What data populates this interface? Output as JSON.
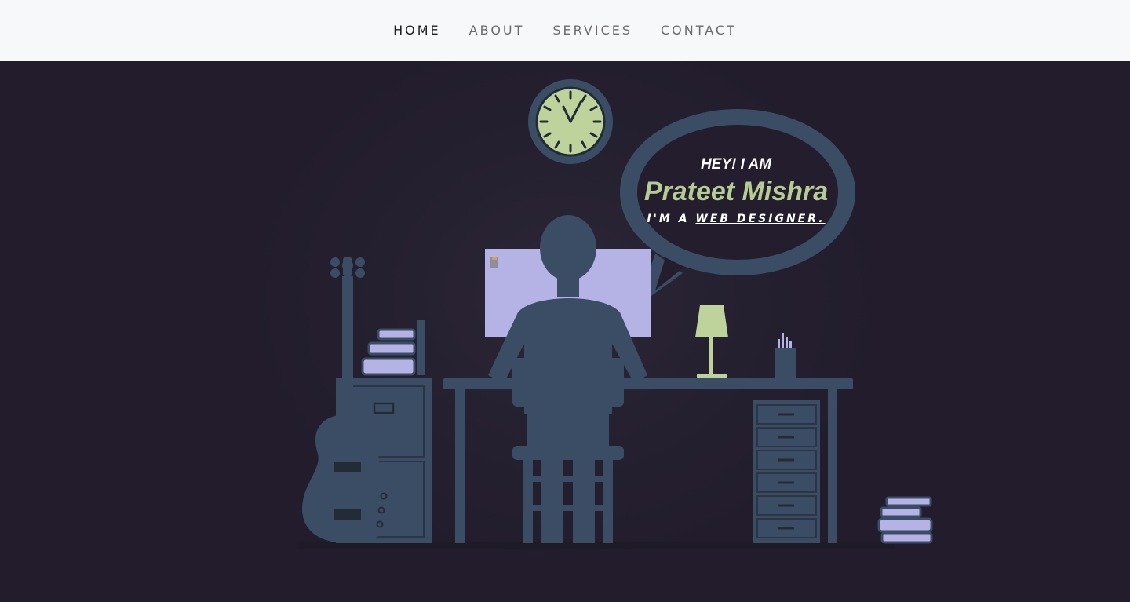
{
  "nav": {
    "items": [
      {
        "label": "HOME",
        "active": true
      },
      {
        "label": "ABOUT",
        "active": false
      },
      {
        "label": "SERVICES",
        "active": false
      },
      {
        "label": "CONTACT",
        "active": false
      }
    ]
  },
  "hero": {
    "greeting": "HEY! I AM",
    "name": "Prateet Mishra",
    "role_prefix": "I'M A",
    "role": "WEB DESIGNER."
  },
  "colors": {
    "background": "#231d2e",
    "nav_bg": "#f7f8fa",
    "silhouette": "#3a4d65",
    "accent_green": "#b6cc95",
    "screen_lavender": "#b5b3e6"
  },
  "icons": [
    "clock-icon",
    "guitar-icon",
    "lamp-icon",
    "pencil-cup-icon",
    "books-icon"
  ]
}
